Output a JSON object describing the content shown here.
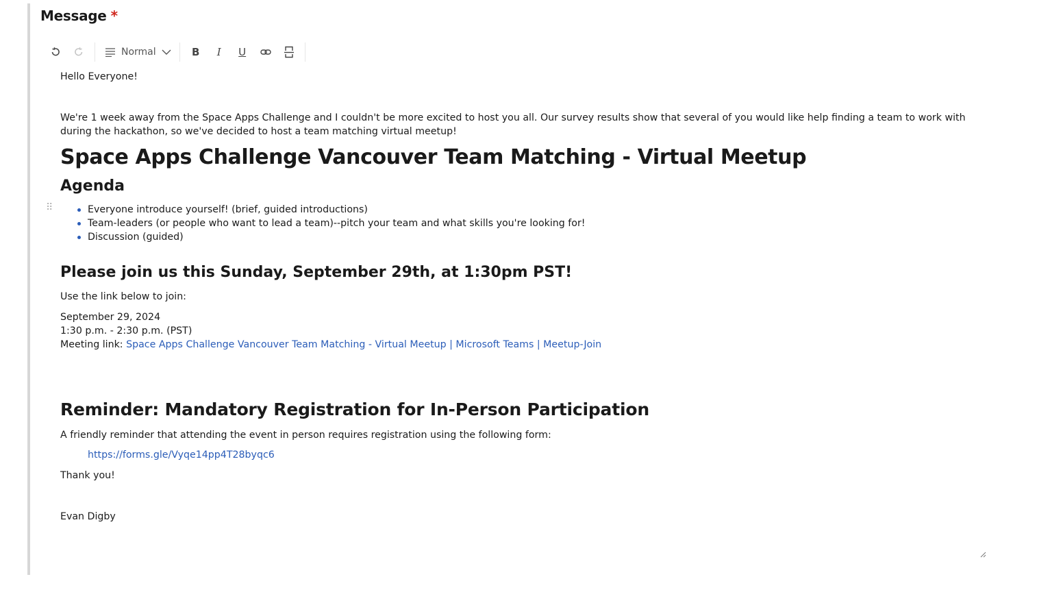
{
  "field": {
    "label": "Message",
    "required_mark": "*"
  },
  "toolbar": {
    "undo_icon": "undo-icon",
    "redo_icon": "redo-icon",
    "format_icon": "paragraph-format-icon",
    "format_value": "Normal",
    "bold_label": "B",
    "italic_label": "I",
    "underline_label": "U",
    "link_icon": "link-icon",
    "more_icon": "horizontal-rule-icon"
  },
  "content": {
    "greeting": "Hello Everyone!",
    "intro": "We're 1 week away from the Space Apps Challenge and I couldn't be more excited to host you all. Our survey results show that several of you would like help finding a team to work with during the hackathon, so we've decided to host a team matching virtual meetup!",
    "heading_main": "Space Apps Challenge Vancouver Team Matching - Virtual Meetup",
    "heading_agenda": "Agenda",
    "agenda_items": [
      "Everyone introduce yourself! (brief, guided introductions)",
      "Team-leaders (or people who want to lead a team)--pitch your team and what skills you're looking for!",
      "Discussion (guided)"
    ],
    "heading_join": "Please join us this Sunday, September 29th, at 1:30pm PST!",
    "use_link": "Use the link below to join:",
    "meeting_date": "September 29, 2024",
    "meeting_time": "1:30 p.m. - 2:30 p.m. (PST)",
    "meeting_link_label": "Meeting link: ",
    "meeting_link_text": "Space Apps Challenge Vancouver Team Matching - Virtual Meetup | Microsoft Teams | Meetup-Join",
    "heading_reminder": "Reminder: Mandatory Registration for In-Person Participation",
    "reminder_text": "A friendly reminder that attending the event in person requires registration using the following form:",
    "form_link": "https://forms.gle/Vyqe14pp4T28byqc6",
    "thanks": "Thank you!",
    "signature": "Evan Digby"
  },
  "colors": {
    "link": "#2b5db8",
    "required": "#d0271d",
    "bullet": "#2b5db8"
  }
}
